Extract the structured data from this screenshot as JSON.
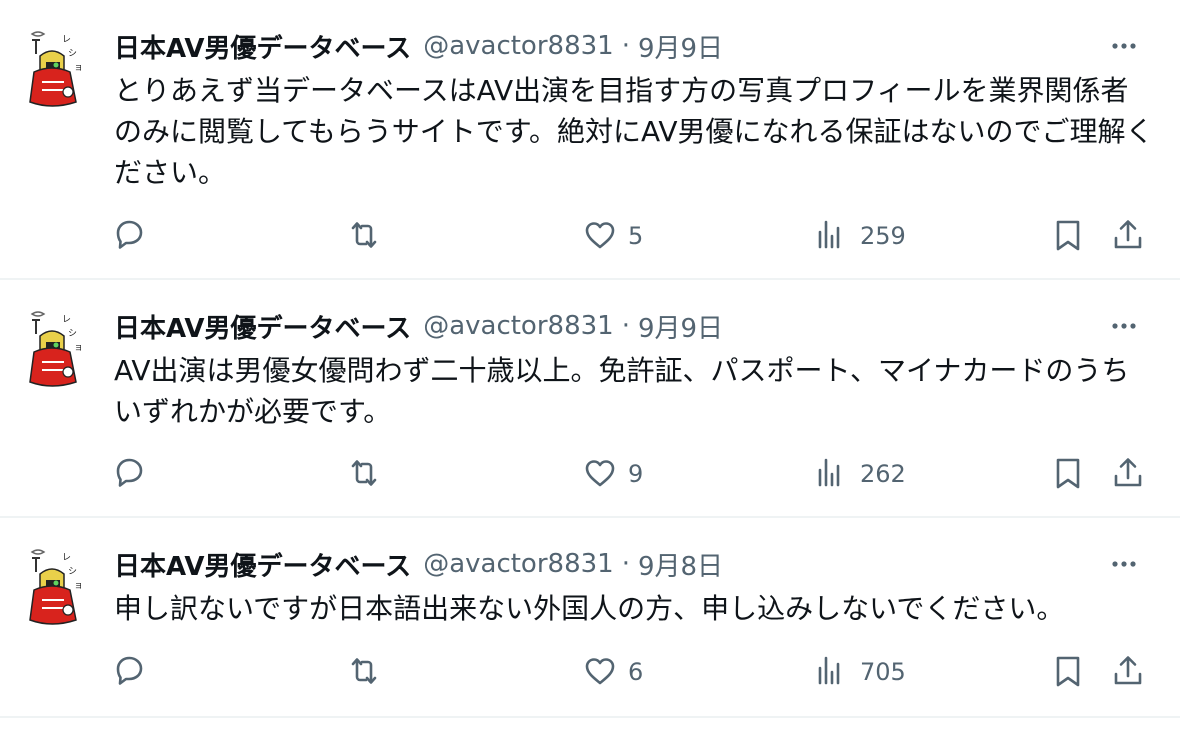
{
  "tweets": [
    {
      "name": "日本AV男優データベース",
      "handle": "@avactor8831",
      "separator": "·",
      "date": "9月9日",
      "text": "とりあえず当データベースはAV出演を目指す方の写真プロフィールを業界関係者のみに閲覧してもらうサイトです。絶対にAV男優になれる保証はないのでご理解ください。",
      "likes": "5",
      "views": "259"
    },
    {
      "name": "日本AV男優データベース",
      "handle": "@avactor8831",
      "separator": "·",
      "date": "9月9日",
      "text": "AV出演は男優女優問わず二十歳以上。免許証、パスポート、マイナカードのうちいずれかが必要です。",
      "likes": "9",
      "views": "262"
    },
    {
      "name": "日本AV男優データベース",
      "handle": "@avactor8831",
      "separator": "·",
      "date": "9月8日",
      "text": "申し訳ないですが日本語出来ない外国人の方、申し込みしないでください。",
      "likes": "6",
      "views": "705"
    }
  ],
  "icons": {
    "reply": "reply-icon",
    "retweet": "retweet-icon",
    "like": "heart-icon",
    "views": "views-icon",
    "bookmark": "bookmark-icon",
    "share": "share-icon",
    "more": "more-icon"
  },
  "colors": {
    "text": "#0f1419",
    "secondary": "#536471",
    "divider": "#eff3f4",
    "avatar_red": "#d8231d"
  }
}
